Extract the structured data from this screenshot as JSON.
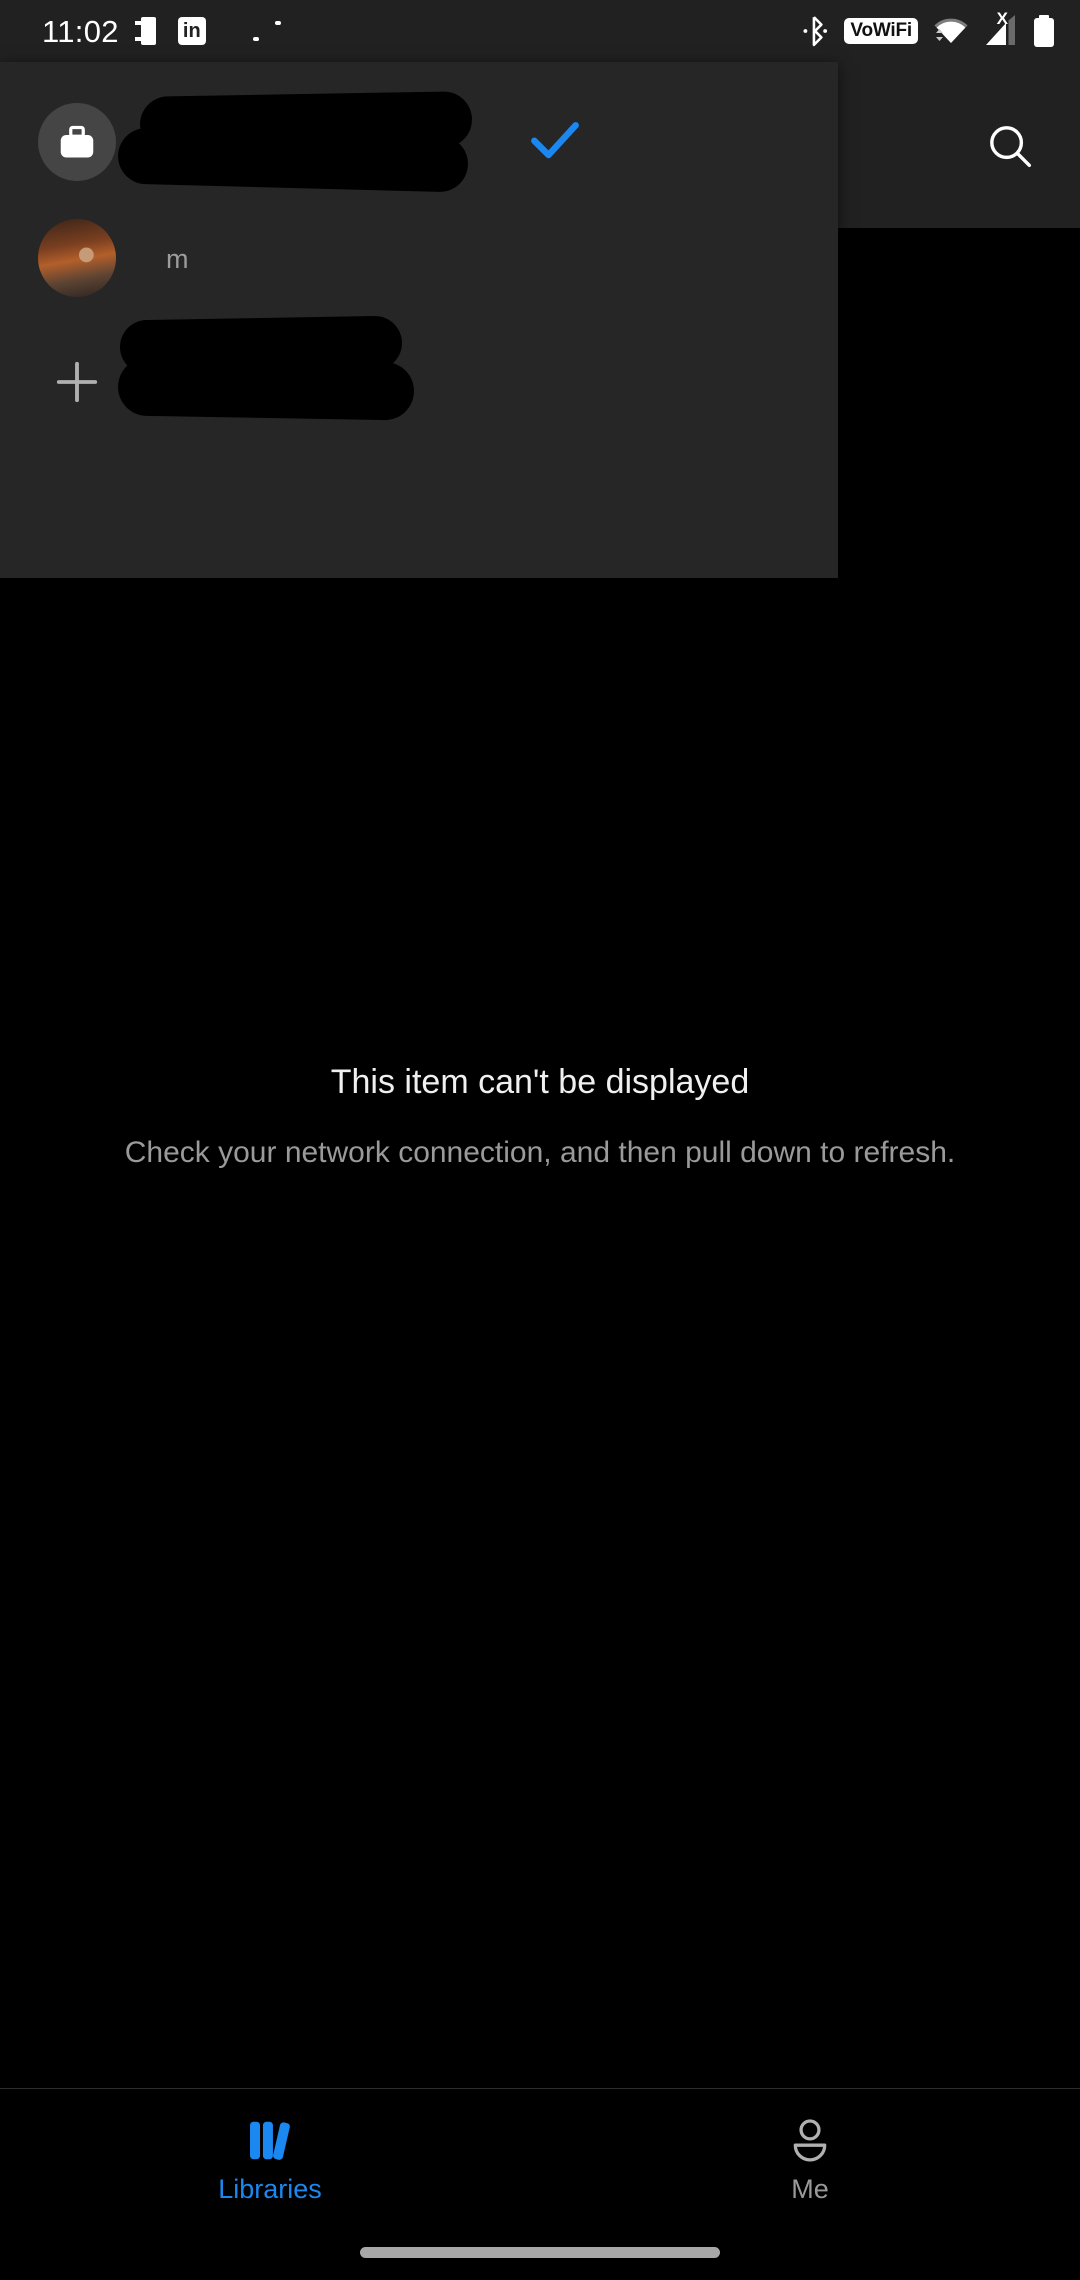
{
  "status_bar": {
    "time": "11:02",
    "icons": [
      {
        "name": "screenshot-icon",
        "label": "screenshot"
      },
      {
        "name": "linkedin-icon",
        "label": "in"
      },
      {
        "name": "bluetooth-icon",
        "label": "bluetooth"
      },
      {
        "name": "vowifi-icon",
        "label": "VoWiFi"
      },
      {
        "name": "wifi-icon",
        "label": "wifi"
      },
      {
        "name": "cellular-signal-icon",
        "label": "X"
      },
      {
        "name": "battery-icon",
        "label": "battery"
      }
    ],
    "vowifi_label": "VoWiFi",
    "linkedin_label": "in",
    "cellular_x_label": "X"
  },
  "app_bar": {
    "search_label": "Search"
  },
  "account_panel": {
    "accounts": [
      {
        "avatar_type": "work-briefcase",
        "name": "",
        "email": "",
        "redacted": true,
        "selected": true
      },
      {
        "avatar_type": "photo",
        "name": "",
        "email": "m",
        "redacted": true,
        "selected": false
      }
    ],
    "add_account_label": "Add account"
  },
  "main": {
    "empty_title": "This item can't be displayed",
    "empty_subtitle": "Check your network connection, and then pull down to refresh."
  },
  "bottom_nav": {
    "items": [
      {
        "label": "Libraries",
        "icon": "books-icon",
        "active": true
      },
      {
        "label": "Me",
        "icon": "person-icon",
        "active": false
      }
    ]
  },
  "colors": {
    "accent_blue": "#1b87f0",
    "panel_bg": "#262626",
    "appbar_bg": "#212121",
    "page_bg": "#000000",
    "muted_text": "#9a9a9a"
  }
}
